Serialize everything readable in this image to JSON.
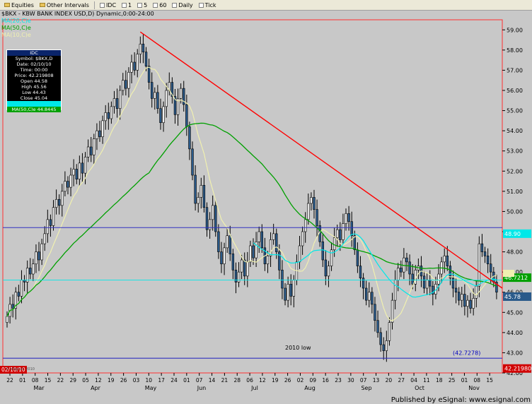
{
  "toolbar": {
    "items": [
      {
        "label": "Equities",
        "icon": "folder-icon"
      },
      {
        "label": "Other Intervals",
        "icon": "folder-icon"
      },
      {
        "label": "IDC",
        "icon": "search-icon"
      },
      {
        "label": "1",
        "icon": "interval-icon"
      },
      {
        "label": "5",
        "icon": "interval-icon"
      },
      {
        "label": "60",
        "icon": "interval-icon"
      },
      {
        "label": "Daily",
        "icon": "interval-icon"
      },
      {
        "label": "Tick",
        "icon": "interval-icon"
      }
    ]
  },
  "chart_title": "$BKX - KBW BANK INDEX USD,D) Dynamic,0:00-24:00",
  "ma_labels": {
    "ma20": "MA(20,C)e",
    "ma50": "MA(50,C)e",
    "ma10": "MA(10,C)e"
  },
  "data_window": {
    "header": "IDC",
    "rows": [
      "Symbol: $BKX,D",
      "Date: 02/10/10",
      "Time: 00:00",
      "Price: 42.219808",
      "Open 44.58",
      "High 45.56",
      "Low 44.43",
      "Close 45.04"
    ],
    "ma20_row": "MA(20,C)e",
    "ma50_row": "MA(50,C)e 44.8445"
  },
  "footer": "Published by eSignal: www.esignal.com",
  "watermark": "© eSignal, 2010",
  "colors": {
    "background": "#c8c8c8",
    "candle_up": "#f0f0f0",
    "candle_down": "#2a5a8a",
    "ma10": "#f0f0b0",
    "ma50": "#00a000",
    "ma20": "#00e8e8",
    "trendline": "#ff0000",
    "hline": "#3030c0"
  },
  "chart_data": {
    "type": "candlestick",
    "ylim": [
      42,
      59.5
    ],
    "y_ticks": [
      "42.00",
      "43.00",
      "44.00",
      "45.00",
      "46.00",
      "47.00",
      "48.00",
      "49.00",
      "50.00",
      "51.00",
      "52.00",
      "53.00",
      "54.00",
      "55.00",
      "56.00",
      "57.00",
      "58.00",
      "59.00"
    ],
    "x_ticks": [
      "22",
      "01",
      "08",
      "15",
      "22",
      "29",
      "05",
      "12",
      "19",
      "26",
      "03",
      "10",
      "17",
      "24",
      "01",
      "07",
      "14",
      "21",
      "28",
      "06",
      "12",
      "19",
      "26",
      "02",
      "09",
      "16",
      "23",
      "30",
      "07",
      "13",
      "20",
      "27",
      "04",
      "11",
      "18",
      "25",
      "01",
      "08",
      "15"
    ],
    "months": [
      "Mar",
      "Apr",
      "May",
      "Jun",
      "Jul",
      "Aug",
      "Sep",
      "Oct",
      "Nov"
    ],
    "start_date_label": "02/10/10",
    "closes": [
      44.8,
      45.4,
      45.2,
      46.0,
      45.8,
      46.6,
      46.5,
      47.2,
      46.9,
      47.4,
      48.0,
      47.6,
      48.4,
      48.9,
      49.6,
      49.3,
      50.2,
      50.6,
      50.3,
      51.0,
      51.5,
      51.2,
      51.8,
      52.1,
      51.6,
      52.4,
      51.9,
      52.7,
      53.2,
      52.8,
      53.6,
      54.0,
      53.7,
      54.5,
      54.9,
      54.6,
      55.2,
      55.6,
      55.1,
      56.0,
      56.5,
      56.1,
      56.9,
      57.4,
      57.0,
      57.8,
      58.3,
      57.9,
      57.2,
      56.4,
      55.6,
      55.9,
      55.1,
      54.4,
      55.2,
      56.0,
      56.4,
      55.7,
      54.8,
      55.6,
      56.1,
      55.3,
      54.2,
      53.1,
      51.8,
      50.4,
      50.7,
      51.3,
      50.2,
      49.1,
      49.6,
      50.3,
      49.0,
      48.0,
      47.4,
      48.2,
      48.8,
      47.9,
      47.1,
      46.5,
      47.0,
      47.6,
      46.8,
      47.5,
      48.3,
      47.7,
      48.5,
      49.0,
      48.2,
      47.4,
      47.8,
      48.6,
      48.9,
      48.0,
      47.1,
      46.2,
      45.6,
      46.4,
      45.8,
      46.6,
      47.5,
      48.3,
      49.0,
      49.6,
      50.4,
      50.7,
      50.1,
      49.3,
      48.5,
      47.6,
      46.8,
      47.3,
      48.1,
      48.7,
      49.1,
      48.6,
      49.4,
      49.9,
      49.5,
      48.8,
      48.1,
      47.3,
      46.7,
      46.2,
      45.6,
      46.0,
      45.4,
      44.6,
      44.0,
      43.4,
      43.1,
      43.6,
      44.5,
      45.6,
      46.6,
      47.2,
      47.0,
      47.7,
      47.5,
      46.9,
      46.4,
      47.1,
      47.3,
      46.8,
      46.2,
      46.6,
      46.3,
      45.9,
      46.4,
      46.9,
      47.5,
      47.8,
      47.3,
      46.7,
      46.2,
      46.0,
      45.6,
      45.9,
      45.3,
      45.6,
      45.2,
      45.7,
      46.3,
      48.4,
      48.0,
      47.8,
      47.4,
      47.0,
      46.5,
      46.0
    ]
  }
}
